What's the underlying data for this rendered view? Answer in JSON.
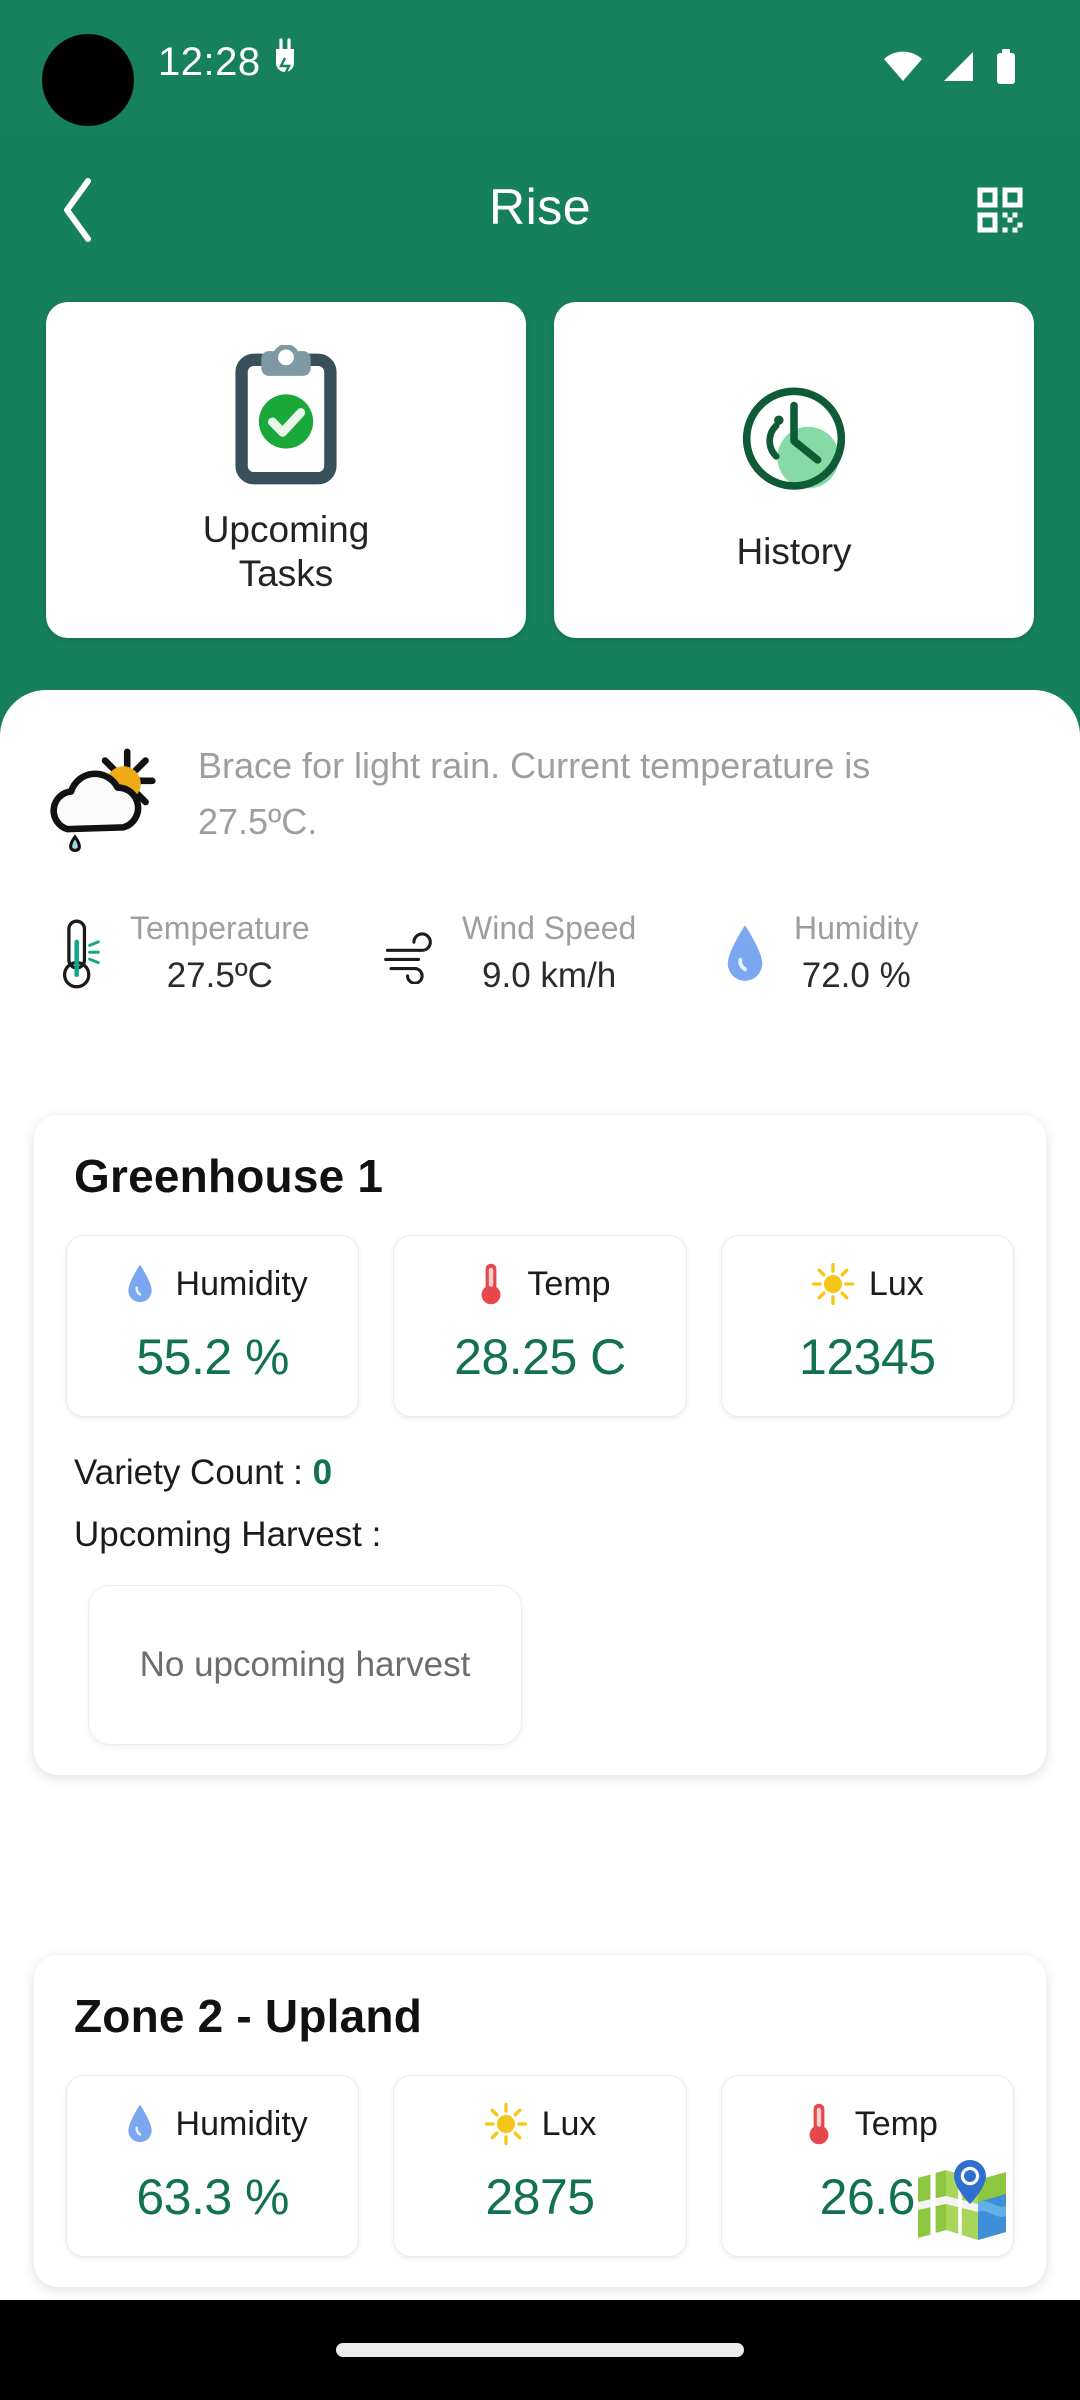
{
  "status_bar": {
    "time": "12:28",
    "icons": [
      "battery-saver-icon",
      "wifi-icon",
      "cellular-signal-icon",
      "battery-icon"
    ]
  },
  "app_bar": {
    "title": "Rise",
    "back_icon": "chevron-left-icon",
    "action_icon": "qr-code-icon"
  },
  "quick_actions": [
    {
      "label": "Upcoming\nTasks",
      "label_line1": "Upcoming",
      "label_line2": "Tasks",
      "icon": "clipboard-check-icon"
    },
    {
      "label": "History",
      "label_line1": "History",
      "label_line2": "",
      "icon": "clock-history-icon"
    }
  ],
  "weather": {
    "icon": "cloud-sun-rain-icon",
    "summary": "Brace for light rain. Current temperature is 27.5ºC.",
    "metrics": [
      {
        "label": "Temperature",
        "value": "27.5ºC",
        "icon": "thermometer-icon"
      },
      {
        "label": "Wind Speed",
        "value": "9.0 km/h",
        "icon": "wind-icon"
      },
      {
        "label": "Humidity",
        "value": "72.0 %",
        "icon": "water-drop-icon"
      }
    ]
  },
  "zones": [
    {
      "title": "Greenhouse 1",
      "metrics": [
        {
          "label": "Humidity",
          "value": "55.2 %",
          "icon": "water-drop-icon"
        },
        {
          "label": "Temp",
          "value": "28.25 C",
          "icon": "thermometer-icon"
        },
        {
          "label": "Lux",
          "value": "12345",
          "icon": "sun-icon"
        }
      ],
      "variety_count_label": "Variety Count : ",
      "variety_count_value": "0",
      "upcoming_harvest_label": "Upcoming Harvest :",
      "harvest_empty_text": "No upcoming harvest"
    },
    {
      "title": "Zone 2 - Upland",
      "metrics": [
        {
          "label": "Humidity",
          "value": "63.3 %",
          "icon": "water-drop-icon"
        },
        {
          "label": "Lux",
          "value": "2875",
          "icon": "sun-icon"
        },
        {
          "label": "Temp",
          "value": "26.6",
          "icon": "thermometer-icon"
        }
      ]
    }
  ],
  "map_fab": {
    "icon": "map-location-icon"
  },
  "colors": {
    "brand_green": "#17815d",
    "value_green": "#12724f",
    "muted_gray": "#9e9e9e",
    "accent_yellow": "#f5c518",
    "accent_red": "#e8474b",
    "accent_blue": "#7aa7f0"
  }
}
